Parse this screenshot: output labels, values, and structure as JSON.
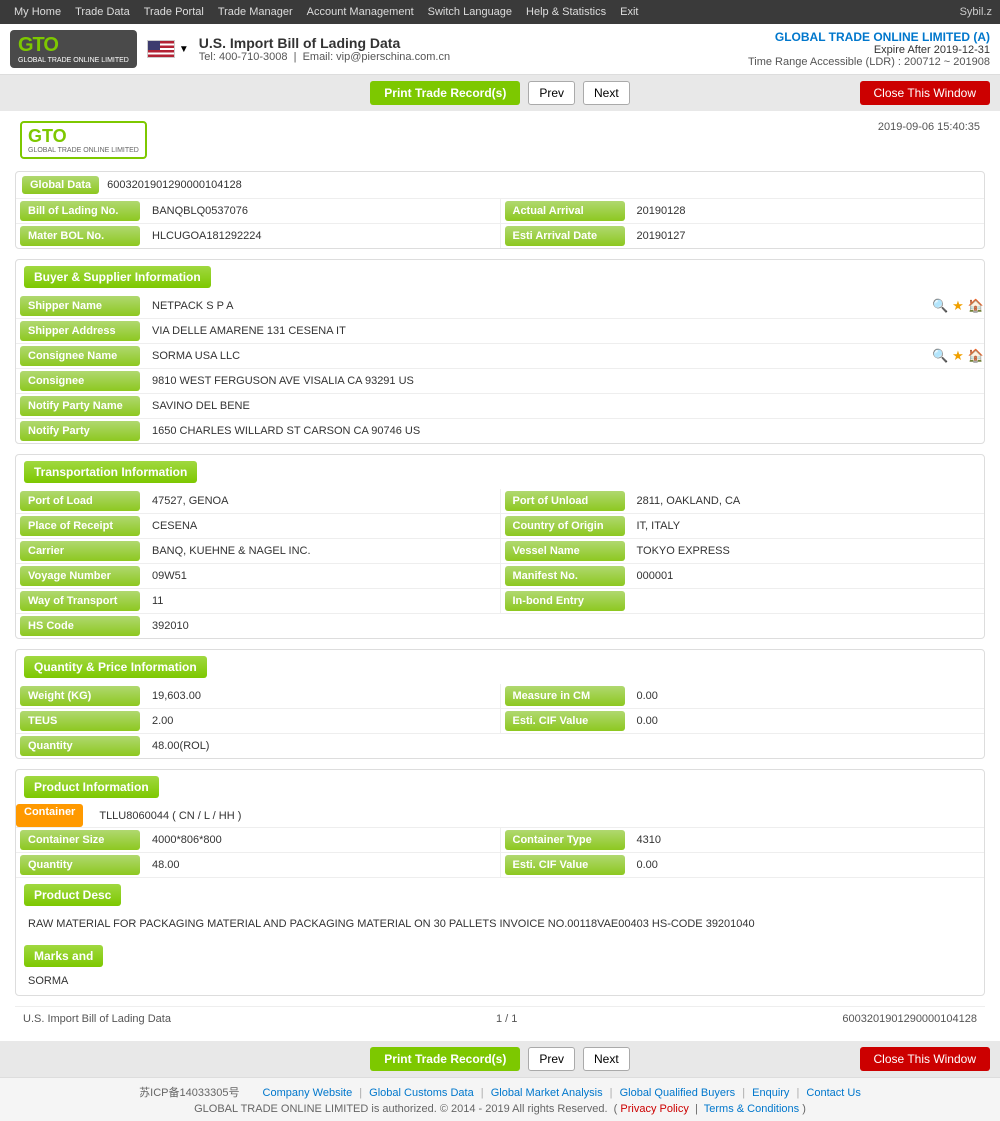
{
  "topnav": {
    "items": [
      "My Home",
      "Trade Data",
      "Trade Portal",
      "Trade Manager",
      "Account Management",
      "Switch Language",
      "Help & Statistics",
      "Exit"
    ],
    "user": "Sybil.z"
  },
  "header": {
    "logo_main": "GTO",
    "logo_sub": "GLOBAL TRADE ONLINE LIMITED",
    "title": "U.S. Import Bill of Lading Data",
    "contact_tel": "Tel: 400-710-3008",
    "contact_email": "Email: vip@pierschina.com.cn",
    "company": "GLOBAL TRADE ONLINE LIMITED (A)",
    "expire": "Expire After 2019-12-31",
    "range": "Time Range Accessible (LDR) : 200712 ~ 201908"
  },
  "toolbar": {
    "print_label": "Print Trade Record(s)",
    "prev_label": "Prev",
    "next_label": "Next",
    "close_label": "Close This Window"
  },
  "document": {
    "timestamp": "2019-09-06 15:40:35",
    "global_data_label": "Global Data",
    "global_data_value": "6003201901290000104128",
    "bol_label": "Bill of Lading No.",
    "bol_value": "BANQBLQ0537076",
    "actual_arrival_label": "Actual Arrival",
    "actual_arrival_value": "20190128",
    "master_bol_label": "Mater BOL No.",
    "master_bol_value": "HLCUGOA181292224",
    "esti_arrival_label": "Esti Arrival Date",
    "esti_arrival_value": "20190127"
  },
  "buyer_supplier": {
    "section_title": "Buyer & Supplier Information",
    "shipper_name_label": "Shipper Name",
    "shipper_name_value": "NETPACK S P A",
    "shipper_address_label": "Shipper Address",
    "shipper_address_value": "VIA DELLE AMARENE 131 CESENA IT",
    "consignee_name_label": "Consignee Name",
    "consignee_name_value": "SORMA USA LLC",
    "consignee_label": "Consignee",
    "consignee_value": "9810 WEST FERGUSON AVE VISALIA CA 93291 US",
    "notify_party_name_label": "Notify Party Name",
    "notify_party_name_value": "SAVINO DEL BENE",
    "notify_party_label": "Notify Party",
    "notify_party_value": "1650 CHARLES WILLARD ST CARSON CA 90746 US"
  },
  "transportation": {
    "section_title": "Transportation Information",
    "port_load_label": "Port of Load",
    "port_load_value": "47527, GENOA",
    "port_unload_label": "Port of Unload",
    "port_unload_value": "2811, OAKLAND, CA",
    "place_receipt_label": "Place of Receipt",
    "place_receipt_value": "CESENA",
    "country_origin_label": "Country of Origin",
    "country_origin_value": "IT, ITALY",
    "carrier_label": "Carrier",
    "carrier_value": "BANQ, KUEHNE & NAGEL INC.",
    "vessel_name_label": "Vessel Name",
    "vessel_name_value": "TOKYO EXPRESS",
    "voyage_label": "Voyage Number",
    "voyage_value": "09W51",
    "manifest_label": "Manifest No.",
    "manifest_value": "000001",
    "way_transport_label": "Way of Transport",
    "way_transport_value": "11",
    "inbond_label": "In-bond Entry",
    "inbond_value": "",
    "hs_code_label": "HS Code",
    "hs_code_value": "392010"
  },
  "quantity_price": {
    "section_title": "Quantity & Price Information",
    "weight_label": "Weight (KG)",
    "weight_value": "19,603.00",
    "measure_label": "Measure in CM",
    "measure_value": "0.00",
    "teus_label": "TEUS",
    "teus_value": "2.00",
    "cif_label": "Esti. CIF Value",
    "cif_value": "0.00",
    "quantity_label": "Quantity",
    "quantity_value": "48.00(ROL)"
  },
  "product": {
    "section_title": "Product Information",
    "container_badge": "Container",
    "container_value": "TLLU8060044 ( CN / L / HH )",
    "container_size_label": "Container Size",
    "container_size_value": "4000*806*800",
    "container_type_label": "Container Type",
    "container_type_value": "4310",
    "quantity_label": "Quantity",
    "quantity_value": "48.00",
    "cif_label": "Esti. CIF Value",
    "cif_value": "0.00",
    "desc_title": "Product Desc",
    "desc_text": "RAW MATERIAL FOR PACKAGING MATERIAL AND PACKAGING MATERIAL ON 30 PALLETS INVOICE NO.00118VAE00403 HS-CODE 39201040",
    "marks_title": "Marks and",
    "marks_value": "SORMA"
  },
  "doc_footer": {
    "left": "U.S. Import Bill of Lading Data",
    "center": "1 / 1",
    "right": "6003201901290000104128"
  },
  "page_footer": {
    "icp": "苏ICP备14033305号",
    "company_website": "Company Website",
    "global_customs": "Global Customs Data",
    "market_analysis": "Global Market Analysis",
    "qualified_buyers": "Global Qualified Buyers",
    "enquiry": "Enquiry",
    "contact_us": "Contact Us",
    "copyright": "GLOBAL TRADE ONLINE LIMITED is authorized. © 2014 - 2019 All rights Reserved.",
    "privacy": "Privacy Policy",
    "terms": "Terms & Conditions"
  }
}
